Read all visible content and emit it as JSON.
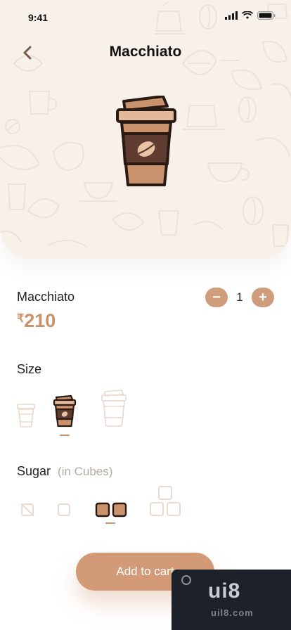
{
  "status_bar": {
    "time": "9:41"
  },
  "header": {
    "title": "Macchiato"
  },
  "product": {
    "name": "Macchiato",
    "currency": "₹",
    "price": "210"
  },
  "quantity": {
    "minus": "−",
    "value": "1",
    "plus": "+"
  },
  "size": {
    "label": "Size",
    "options": [
      "small",
      "medium",
      "large"
    ],
    "selected": "medium"
  },
  "sugar": {
    "label": "Sugar",
    "hint": "(in Cubes)",
    "options": [
      "none",
      "one",
      "two",
      "three"
    ],
    "selected": "two"
  },
  "cta": {
    "label": "Add to cart"
  },
  "watermark": {
    "text": "ui8",
    "sub": "uil8.com"
  },
  "colors": {
    "accent": "#cf9d7c",
    "price": "#c9916c",
    "hero_bg": "#f7f1ea",
    "cup_dark": "#2a1a14"
  },
  "icons": [
    "back-chevron-icon",
    "signal-icon",
    "wifi-icon",
    "battery-icon",
    "coffee-cup-icon",
    "coffee-bean-icon",
    "sugar-cube-icon"
  ]
}
